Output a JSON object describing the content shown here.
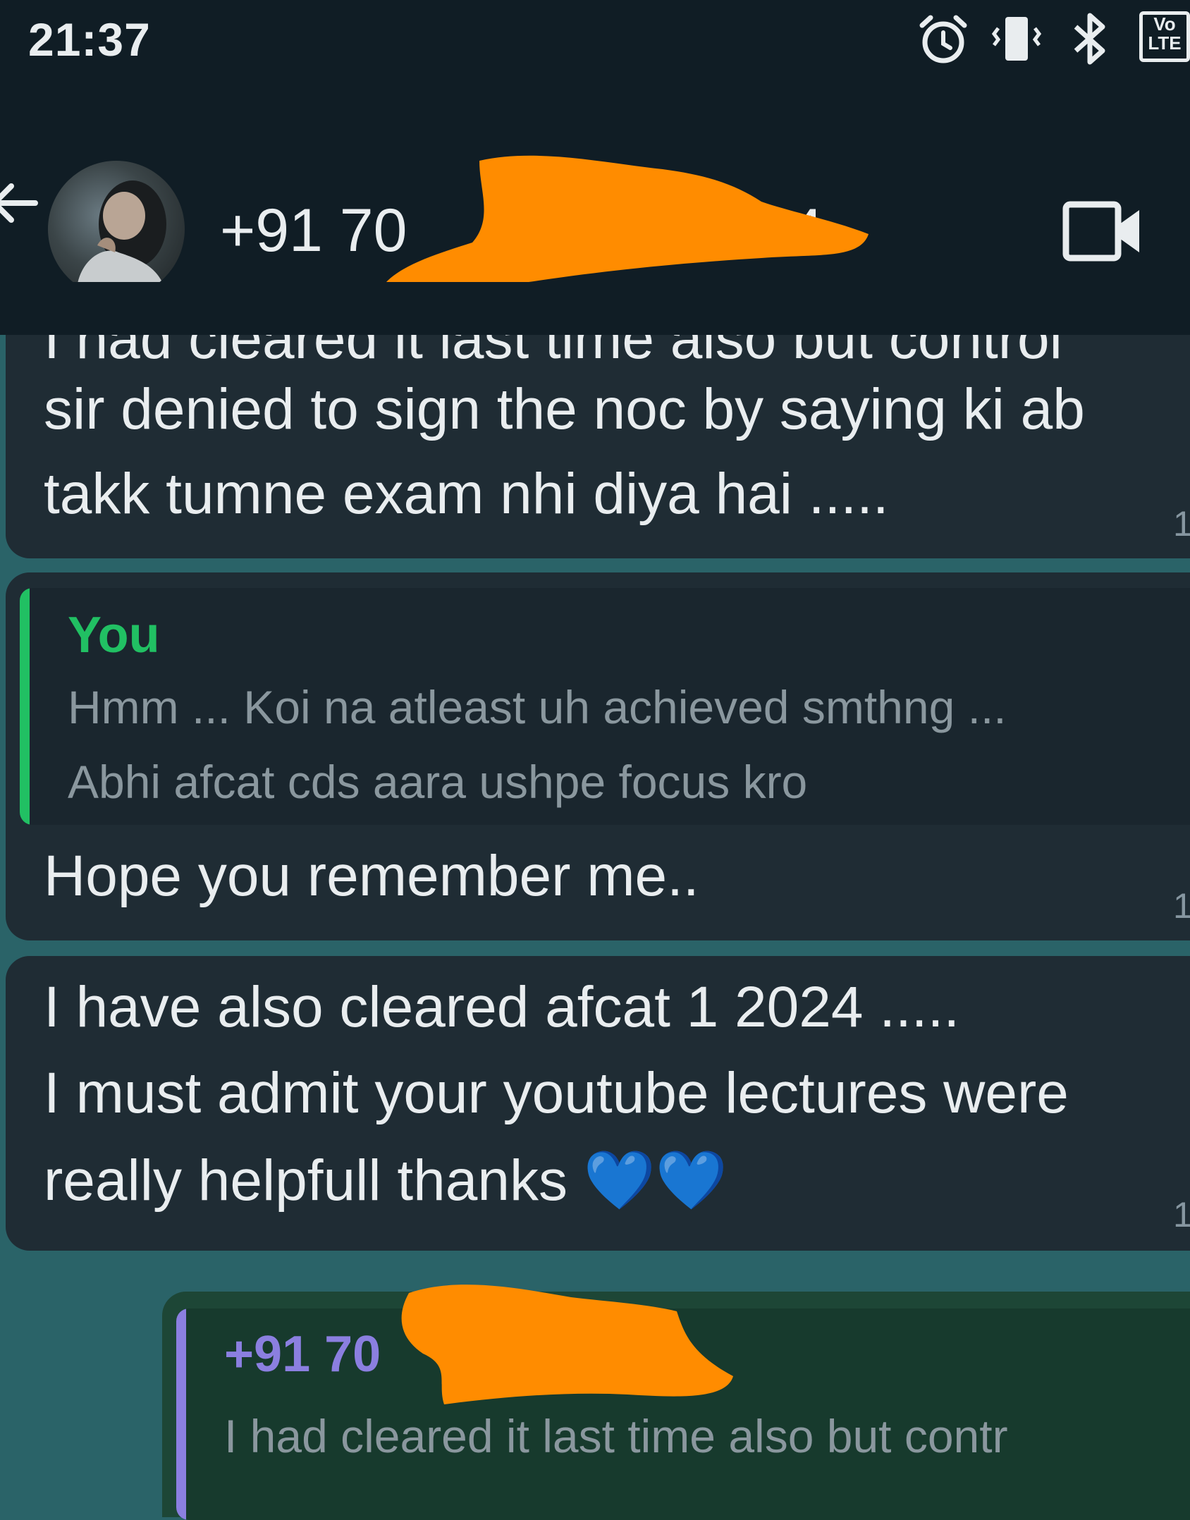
{
  "status_bar": {
    "time": "21:37",
    "icons": [
      "alarm-icon",
      "vibrate-icon",
      "bluetooth-icon",
      "volte-icon"
    ],
    "volte_line1": "Vo",
    "volte_line2": "LTE"
  },
  "header": {
    "contact_name": "+91 70",
    "contact_name_tail": "4"
  },
  "messages": [
    {
      "direction": "in",
      "lines": [
        "I had cleared it last time also but control",
        "sir denied to sign the noc by saying ki ab",
        "takk tumne exam nhi diya hai ....."
      ],
      "time": "1"
    },
    {
      "direction": "in",
      "reply_to": {
        "author": "You",
        "lines": [
          "Hmm ... Koi na atleast uh achieved smthng ...",
          "Abhi afcat cds aara ushpe focus kro"
        ]
      },
      "lines": [
        "Hope you remember me.."
      ],
      "time": "1"
    },
    {
      "direction": "in",
      "lines": [
        "I have also cleared afcat 1 2024 .....",
        "I must admit your youtube lectures were",
        "really helpfull thanks 💙💙"
      ],
      "time": "1"
    },
    {
      "direction": "out",
      "reply_to": {
        "author": "+91 70",
        "lines": [
          "I had cleared it last time also but contr"
        ]
      }
    }
  ],
  "colors": {
    "header_bg": "#101d25",
    "chat_bg": "#2a6368",
    "incoming_bubble": "#1f2c34",
    "outgoing_bubble": "#1d4636",
    "you_accent": "#21c063",
    "contact_accent": "#8b7fe0",
    "redaction": "#ff8c00"
  }
}
